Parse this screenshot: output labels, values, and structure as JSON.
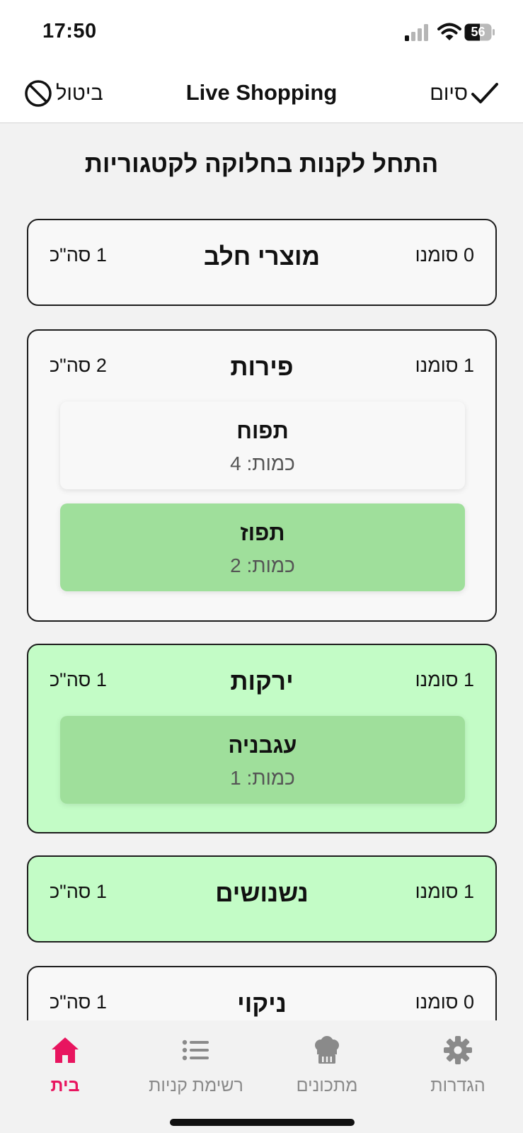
{
  "status_bar": {
    "time": "17:50",
    "battery": "56"
  },
  "nav": {
    "title": "Live Shopping",
    "cancel_label": "ביטול",
    "finish_label": "סיום"
  },
  "heading": "התחל לקנות בחלוקה לקטגוריות",
  "categories": [
    {
      "name": "מוצרי חלב",
      "marked": "0 סומנו",
      "total": "1 סה\"כ",
      "done": false,
      "items": []
    },
    {
      "name": "פירות",
      "marked": "1 סומנו",
      "total": "2 סה\"כ",
      "done": false,
      "items": [
        {
          "name": "תפוח",
          "qty": "כמות: 4",
          "checked": false
        },
        {
          "name": "תפוז",
          "qty": "כמות: 2",
          "checked": true
        }
      ]
    },
    {
      "name": "ירקות",
      "marked": "1 סומנו",
      "total": "1 סה\"כ",
      "done": true,
      "items": [
        {
          "name": "עגבניה",
          "qty": "כמות: 1",
          "checked": true
        }
      ]
    },
    {
      "name": "נשנושים",
      "marked": "1 סומנו",
      "total": "1 סה\"כ",
      "done": true,
      "items": []
    },
    {
      "name": "ניקוי",
      "marked": "0 סומנו",
      "total": "1 סה\"כ",
      "done": false,
      "items": []
    }
  ],
  "tabs": [
    {
      "label": "הגדרות",
      "icon": "gear-icon",
      "active": false
    },
    {
      "label": "מתכונים",
      "icon": "chef-hat-icon",
      "active": false
    },
    {
      "label": "רשימת קניות",
      "icon": "list-icon",
      "active": false
    },
    {
      "label": "בית",
      "icon": "home-icon",
      "active": true
    }
  ],
  "colors": {
    "accent": "#e8155f",
    "done_card": "#c3fcc6",
    "checked_item": "#9fdf9b",
    "inactive_tab": "#8a8a8a"
  }
}
